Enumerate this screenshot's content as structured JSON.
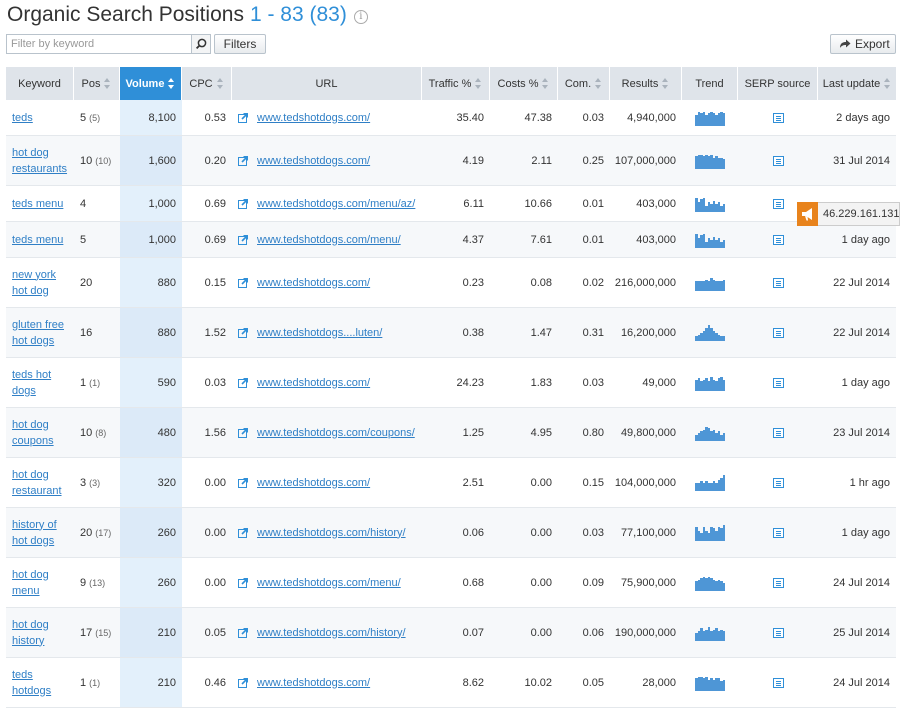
{
  "header": {
    "title": "Organic Search Positions",
    "range": "1 - 83 (83)",
    "info_icon": "info-icon"
  },
  "toolbar": {
    "search_placeholder": "Filter by keyword",
    "search_value": "",
    "search_icon": "search-icon",
    "filters_label": "Filters",
    "export_label": "Export",
    "export_icon": "export-arrow-icon"
  },
  "table": {
    "columns": [
      "Keyword",
      "Pos",
      "Volume",
      "CPC",
      "URL",
      "Traffic %",
      "Costs %",
      "Com.",
      "Results",
      "Trend",
      "SERP source",
      "Last update"
    ],
    "sorted_column": "Volume",
    "rows": [
      {
        "keyword": "teds",
        "pos": "5",
        "pos_prev": "(5)",
        "volume": "8,100",
        "cpc": "0.53",
        "url": "www.tedshotdogs.com/",
        "traffic": "35.40",
        "costs": "47.38",
        "com": "0.03",
        "results": "4,940,000",
        "trend": [
          0.7,
          0.9,
          0.8,
          0.9,
          0.7,
          0.8,
          0.9,
          0.8,
          0.7,
          0.8,
          0.9,
          0.8
        ],
        "last_update": "2 days ago"
      },
      {
        "keyword": "hot dog restaurants",
        "pos": "10",
        "pos_prev": "(10)",
        "volume": "1,600",
        "cpc": "0.20",
        "url": "www.tedshotdogs.com/",
        "traffic": "4.19",
        "costs": "2.11",
        "com": "0.25",
        "results": "107,000,000",
        "trend": [
          0.8,
          0.9,
          0.9,
          0.8,
          0.9,
          0.8,
          0.9,
          0.7,
          0.8,
          0.7,
          0.7,
          0.6
        ],
        "last_update": "31 Jul 2014"
      },
      {
        "keyword": "teds menu",
        "pos": "4",
        "pos_prev": "",
        "volume": "1,000",
        "cpc": "0.69",
        "url": "www.tedshotdogs.com/menu/az/",
        "traffic": "6.11",
        "costs": "10.66",
        "com": "0.01",
        "results": "403,000",
        "trend": [
          0.9,
          0.6,
          0.8,
          0.9,
          0.4,
          0.6,
          0.5,
          0.7,
          0.5,
          0.6,
          0.4,
          0.5
        ],
        "last_update": ""
      },
      {
        "keyword": "teds menu",
        "pos": "5",
        "pos_prev": "",
        "volume": "1,000",
        "cpc": "0.69",
        "url": "www.tedshotdogs.com/menu/",
        "traffic": "4.37",
        "costs": "7.61",
        "com": "0.01",
        "results": "403,000",
        "trend": [
          0.9,
          0.6,
          0.8,
          0.9,
          0.4,
          0.6,
          0.5,
          0.7,
          0.5,
          0.6,
          0.4,
          0.5
        ],
        "last_update": "1 day ago"
      },
      {
        "keyword": "new york hot dog",
        "pos": "20",
        "pos_prev": "",
        "volume": "880",
        "cpc": "0.15",
        "url": "www.tedshotdogs.com/",
        "traffic": "0.23",
        "costs": "0.08",
        "com": "0.02",
        "results": "216,000,000",
        "trend": [
          0.6,
          0.6,
          0.6,
          0.6,
          0.7,
          0.6,
          0.8,
          0.7,
          0.6,
          0.6,
          0.6,
          0.7
        ],
        "last_update": "22 Jul 2014"
      },
      {
        "keyword": "gluten free hot dogs",
        "pos": "16",
        "pos_prev": "",
        "volume": "880",
        "cpc": "1.52",
        "url": "www.tedshotdogs....luten/",
        "traffic": "0.38",
        "costs": "1.47",
        "com": "0.31",
        "results": "16,200,000",
        "trend": [
          0.3,
          0.4,
          0.5,
          0.6,
          0.8,
          1.0,
          0.8,
          0.6,
          0.5,
          0.4,
          0.3,
          0.3
        ],
        "last_update": "22 Jul 2014"
      },
      {
        "keyword": "teds hot dogs",
        "pos": "1",
        "pos_prev": "(1)",
        "volume": "590",
        "cpc": "0.03",
        "url": "www.tedshotdogs.com/",
        "traffic": "24.23",
        "costs": "1.83",
        "com": "0.03",
        "results": "49,000",
        "trend": [
          0.7,
          0.8,
          0.6,
          0.7,
          0.8,
          0.6,
          0.9,
          0.7,
          0.6,
          0.8,
          0.9,
          0.7
        ],
        "last_update": "1 day ago"
      },
      {
        "keyword": "hot dog coupons",
        "pos": "10",
        "pos_prev": "(8)",
        "volume": "480",
        "cpc": "1.56",
        "url": "www.tedshotdogs.com/coupons/",
        "traffic": "1.25",
        "costs": "4.95",
        "com": "0.80",
        "results": "49,800,000",
        "trend": [
          0.4,
          0.5,
          0.6,
          0.7,
          0.9,
          0.8,
          0.6,
          0.7,
          0.5,
          0.6,
          0.4,
          0.5
        ],
        "last_update": "23 Jul 2014"
      },
      {
        "keyword": "hot dog restaurant",
        "pos": "3",
        "pos_prev": "(3)",
        "volume": "320",
        "cpc": "0.00",
        "url": "www.tedshotdogs.com/",
        "traffic": "2.51",
        "costs": "0.00",
        "com": "0.15",
        "results": "104,000,000",
        "trend": [
          0.5,
          0.5,
          0.6,
          0.5,
          0.6,
          0.5,
          0.5,
          0.6,
          0.5,
          0.7,
          0.8,
          1.0
        ],
        "last_update": "1 hr ago"
      },
      {
        "keyword": "history of hot dogs",
        "pos": "20",
        "pos_prev": "(17)",
        "volume": "260",
        "cpc": "0.00",
        "url": "www.tedshotdogs.com/history/",
        "traffic": "0.06",
        "costs": "0.00",
        "com": "0.03",
        "results": "77,100,000",
        "trend": [
          0.9,
          0.6,
          0.5,
          0.9,
          0.6,
          0.5,
          0.9,
          0.8,
          0.6,
          0.9,
          0.8,
          1.0
        ],
        "last_update": "1 day ago"
      },
      {
        "keyword": "hot dog menu",
        "pos": "9",
        "pos_prev": "(13)",
        "volume": "260",
        "cpc": "0.00",
        "url": "www.tedshotdogs.com/menu/",
        "traffic": "0.68",
        "costs": "0.00",
        "com": "0.09",
        "results": "75,900,000",
        "trend": [
          0.6,
          0.7,
          0.8,
          0.9,
          0.8,
          0.9,
          0.8,
          0.7,
          0.6,
          0.7,
          0.6,
          0.5
        ],
        "last_update": "24 Jul 2014"
      },
      {
        "keyword": "hot dog history",
        "pos": "17",
        "pos_prev": "(15)",
        "volume": "210",
        "cpc": "0.05",
        "url": "www.tedshotdogs.com/history/",
        "traffic": "0.07",
        "costs": "0.00",
        "com": "0.06",
        "results": "190,000,000",
        "trend": [
          0.5,
          0.6,
          0.8,
          0.6,
          0.7,
          0.9,
          0.6,
          0.7,
          0.8,
          0.6,
          0.7,
          0.6
        ],
        "last_update": "25 Jul 2014"
      },
      {
        "keyword": "teds hotdogs",
        "pos": "1",
        "pos_prev": "(1)",
        "volume": "210",
        "cpc": "0.46",
        "url": "www.tedshotdogs.com/",
        "traffic": "8.62",
        "costs": "10.02",
        "com": "0.05",
        "results": "28,000",
        "trend": [
          0.8,
          0.9,
          0.9,
          0.8,
          0.9,
          0.7,
          0.8,
          0.7,
          0.8,
          0.8,
          0.6,
          0.7
        ],
        "last_update": "24 Jul 2014"
      }
    ]
  },
  "ip_badge": {
    "text": "46.229.161.131",
    "icon": "megaphone-icon"
  },
  "colors": {
    "accent": "#2f8fd8",
    "header_bg": "#dfe4ea",
    "link": "#2f7fc6",
    "trend_bar": "#4e96d6",
    "badge": "#e8831c"
  }
}
